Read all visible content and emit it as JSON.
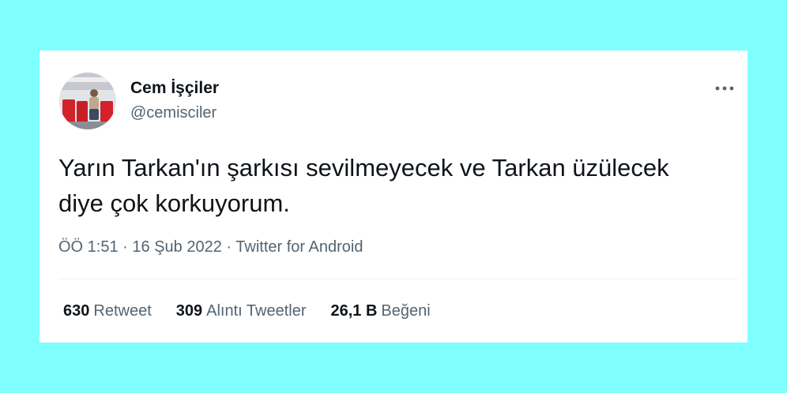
{
  "tweet": {
    "author": {
      "display_name": "Cem İşçiler",
      "handle": "@cemisciler",
      "avatar_icon": "profile-photo"
    },
    "more_icon": "more-options-icon",
    "text_lines": [
      "Yarın Tarkan'ın şarkısı sevilmeyecek ve Tarkan üzülecek",
      "diye çok korkuyorum."
    ],
    "meta": {
      "time": "ÖÖ 1:51",
      "separator": "·",
      "date": "16 Şub 2022",
      "source": "Twitter for Android"
    },
    "stats": [
      {
        "count": "630",
        "label": "Retweet"
      },
      {
        "count": "309",
        "label": "Alıntı Tweetler"
      },
      {
        "count": "26,1 B",
        "label": "Beğeni"
      }
    ]
  },
  "colors": {
    "background": "#80FFFF",
    "card": "#FFFFFF",
    "primary_text": "#0F1419",
    "secondary_text": "#536471",
    "divider": "#EFF3F4"
  }
}
